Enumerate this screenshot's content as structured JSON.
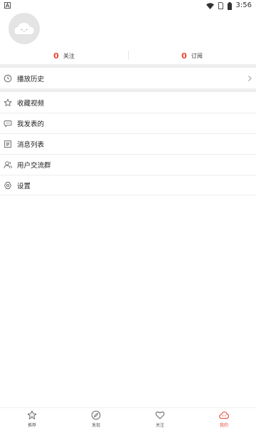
{
  "status_bar": {
    "time": "3:56"
  },
  "profile": {
    "following_count": "0",
    "following_label": "关注",
    "subscribe_count": "0",
    "subscribe_label": "订阅"
  },
  "menu": {
    "history": "播放历史",
    "favorites": "收藏视频",
    "my_posts": "我发表的",
    "messages": "消息列表",
    "user_group": "用户交流群",
    "settings": "设置"
  },
  "tabs": [
    {
      "label": "推荐",
      "icon": "star-icon",
      "active": false
    },
    {
      "label": "发现",
      "icon": "compass-icon",
      "active": false
    },
    {
      "label": "关注",
      "icon": "heart-icon",
      "active": false
    },
    {
      "label": "我的",
      "icon": "cloud-icon",
      "active": true
    }
  ],
  "colors": {
    "accent": "#e8452f",
    "divider": "#eeeeee",
    "icon_gray": "#666666"
  }
}
